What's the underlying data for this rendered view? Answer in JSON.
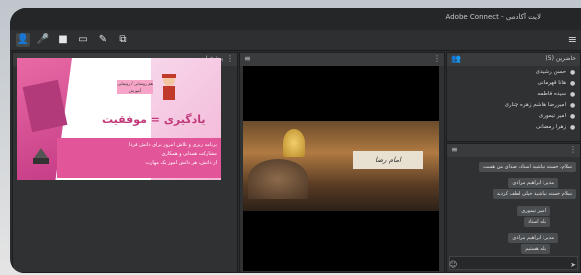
{
  "window": {
    "title": "Adobe Connect - لایت آکادمی"
  },
  "toolbar": {
    "buttons": [
      {
        "name": "attendees-icon",
        "glyph": "👤"
      },
      {
        "name": "microphone-icon",
        "glyph": "🎤"
      },
      {
        "name": "camera-icon",
        "glyph": "■"
      },
      {
        "name": "share-screen-icon",
        "glyph": "▭"
      },
      {
        "name": "draw-icon",
        "glyph": "✎"
      },
      {
        "name": "layout-icon",
        "glyph": "⧉"
      }
    ],
    "menu_icon": "≡"
  },
  "pods": {
    "share": {
      "title": "پیشخوان",
      "options_icon": "⋮"
    },
    "video": {
      "options_icon": "≡",
      "menu_icon": "⋮"
    },
    "attendees": {
      "title": "(5) حاضرین",
      "people": [
        "حسن رشیدی",
        "هانا قهرمانی",
        "سیده فاطمه",
        "امیررضا هاشم زهره چناری",
        "امیر تیموری",
        "زهرا رمضانی"
      ]
    },
    "chat": {
      "header_icon": "≡",
      "messages": [
        "سلام، خسته نباشید استاد، صدای من هست",
        "مدیر: ابراهیم مرادی",
        "سلام خسته نباشید خیلی لطف کردید",
        "امیر تیموری",
        "بله استاد",
        "مدیر: ابراهیم مرادی",
        "بله هستیم"
      ]
    }
  },
  "slide": {
    "heading": "یادگیری = موفقیت",
    "ribbon": "هم رونمایی / رونمایی آموزش",
    "line1": "برنامه ریزی و تلاش امروز برای دانش فردا",
    "line2": "مشارکت همدلی و همکاری",
    "line3": "از دانش، هر دانش آموز یک مهارت"
  },
  "video": {
    "caption": "امام رضا"
  }
}
